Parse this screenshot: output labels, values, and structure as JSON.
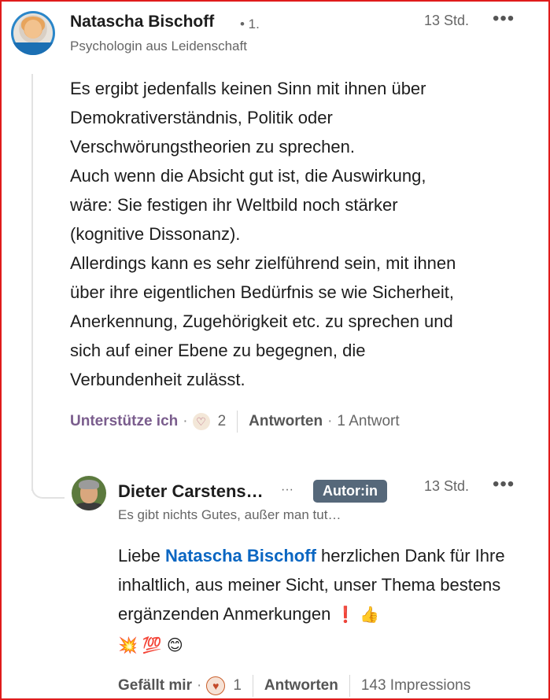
{
  "comment": {
    "author": "Natascha Bischoff",
    "degree": "• 1.",
    "headline": "Psychologin aus Leidenschaft",
    "time": "13 Std.",
    "more_icon": "•••",
    "text": "Es ergibt jedenfalls keinen Sinn mit ihnen über\nDemokrativerständnis, Politik oder\nVerschwörungstheorien zu sprechen.\nAuch wenn die Absicht gut ist, die Auswirkung,\nwäre: Sie festigen ihr Weltbild noch stärker\n(kognitive Dissonanz).\nAllerdings kann es sehr zielführend sein, mit ihnen\nüber ihre eigentlichen Bedürfnis se wie Sicherheit,\nAnerkennung, Zugehörigkeit etc. zu sprechen und\nsich auf einer Ebene zu begegnen, die\nVerbundenheit zulässt.",
    "support_label": "Unterstütze ich",
    "reaction_icon": "support-icon",
    "reaction_count": "2",
    "reply_label": "Antworten",
    "reply_count": "1 Antwort"
  },
  "reply": {
    "author": "Dieter Carstens…",
    "ellipsis": "···",
    "badge": "Autor:in",
    "time": "13 Std.",
    "more_icon": "•••",
    "headline": "Es gibt nichts Gutes, außer man tut…",
    "text_before": "Liebe ",
    "mention": "Natascha Bischoff",
    "text_after": " herzlichen Dank für Ihre inhaltlich, aus meiner Sicht, unser Thema bestens ergänzenden Anmerkungen",
    "emojis": [
      "❗",
      "👍",
      "💥",
      "💯",
      "😊"
    ],
    "like_label": "Gefällt mir",
    "like_icon": "heart-icon",
    "like_count": "1",
    "reply_label": "Antworten",
    "impressions": "143 Impressions"
  },
  "colors": {
    "frame": "#e01b1b",
    "mention": "#0a66c2",
    "support": "#7a5d8d",
    "badge": "#56687a"
  }
}
